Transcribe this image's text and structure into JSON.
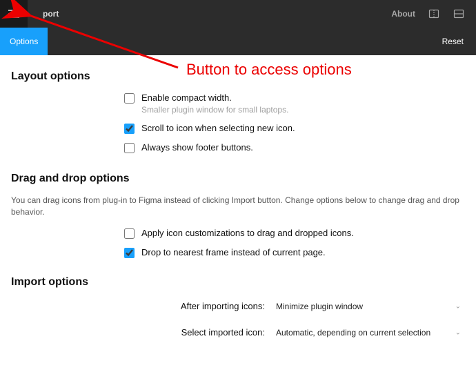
{
  "topbar": {
    "title": "port",
    "about_label": "About"
  },
  "optionsbar": {
    "tab_label": "Options",
    "reset_label": "Reset"
  },
  "sections": {
    "layout": {
      "title": "Layout options",
      "items": [
        {
          "label": "Enable compact width.",
          "sub": "Smaller plugin window for small laptops.",
          "checked": false
        },
        {
          "label": "Scroll to icon when selecting new icon.",
          "checked": true
        },
        {
          "label": "Always show footer buttons.",
          "checked": false
        }
      ]
    },
    "drag": {
      "title": "Drag and drop options",
      "desc": "You can drag icons from plug-in to Figma instead of clicking Import button. Change options below to change drag and drop behavior.",
      "items": [
        {
          "label": "Apply icon customizations to drag and dropped icons.",
          "checked": false
        },
        {
          "label": "Drop to nearest frame instead of current page.",
          "checked": true
        }
      ]
    },
    "import": {
      "title": "Import options",
      "selects": [
        {
          "label": "After importing icons:",
          "value": "Minimize plugin window"
        },
        {
          "label": "Select imported icon:",
          "value": "Automatic, depending on current selection"
        }
      ]
    }
  },
  "annotation": {
    "text": "Button to access options"
  }
}
